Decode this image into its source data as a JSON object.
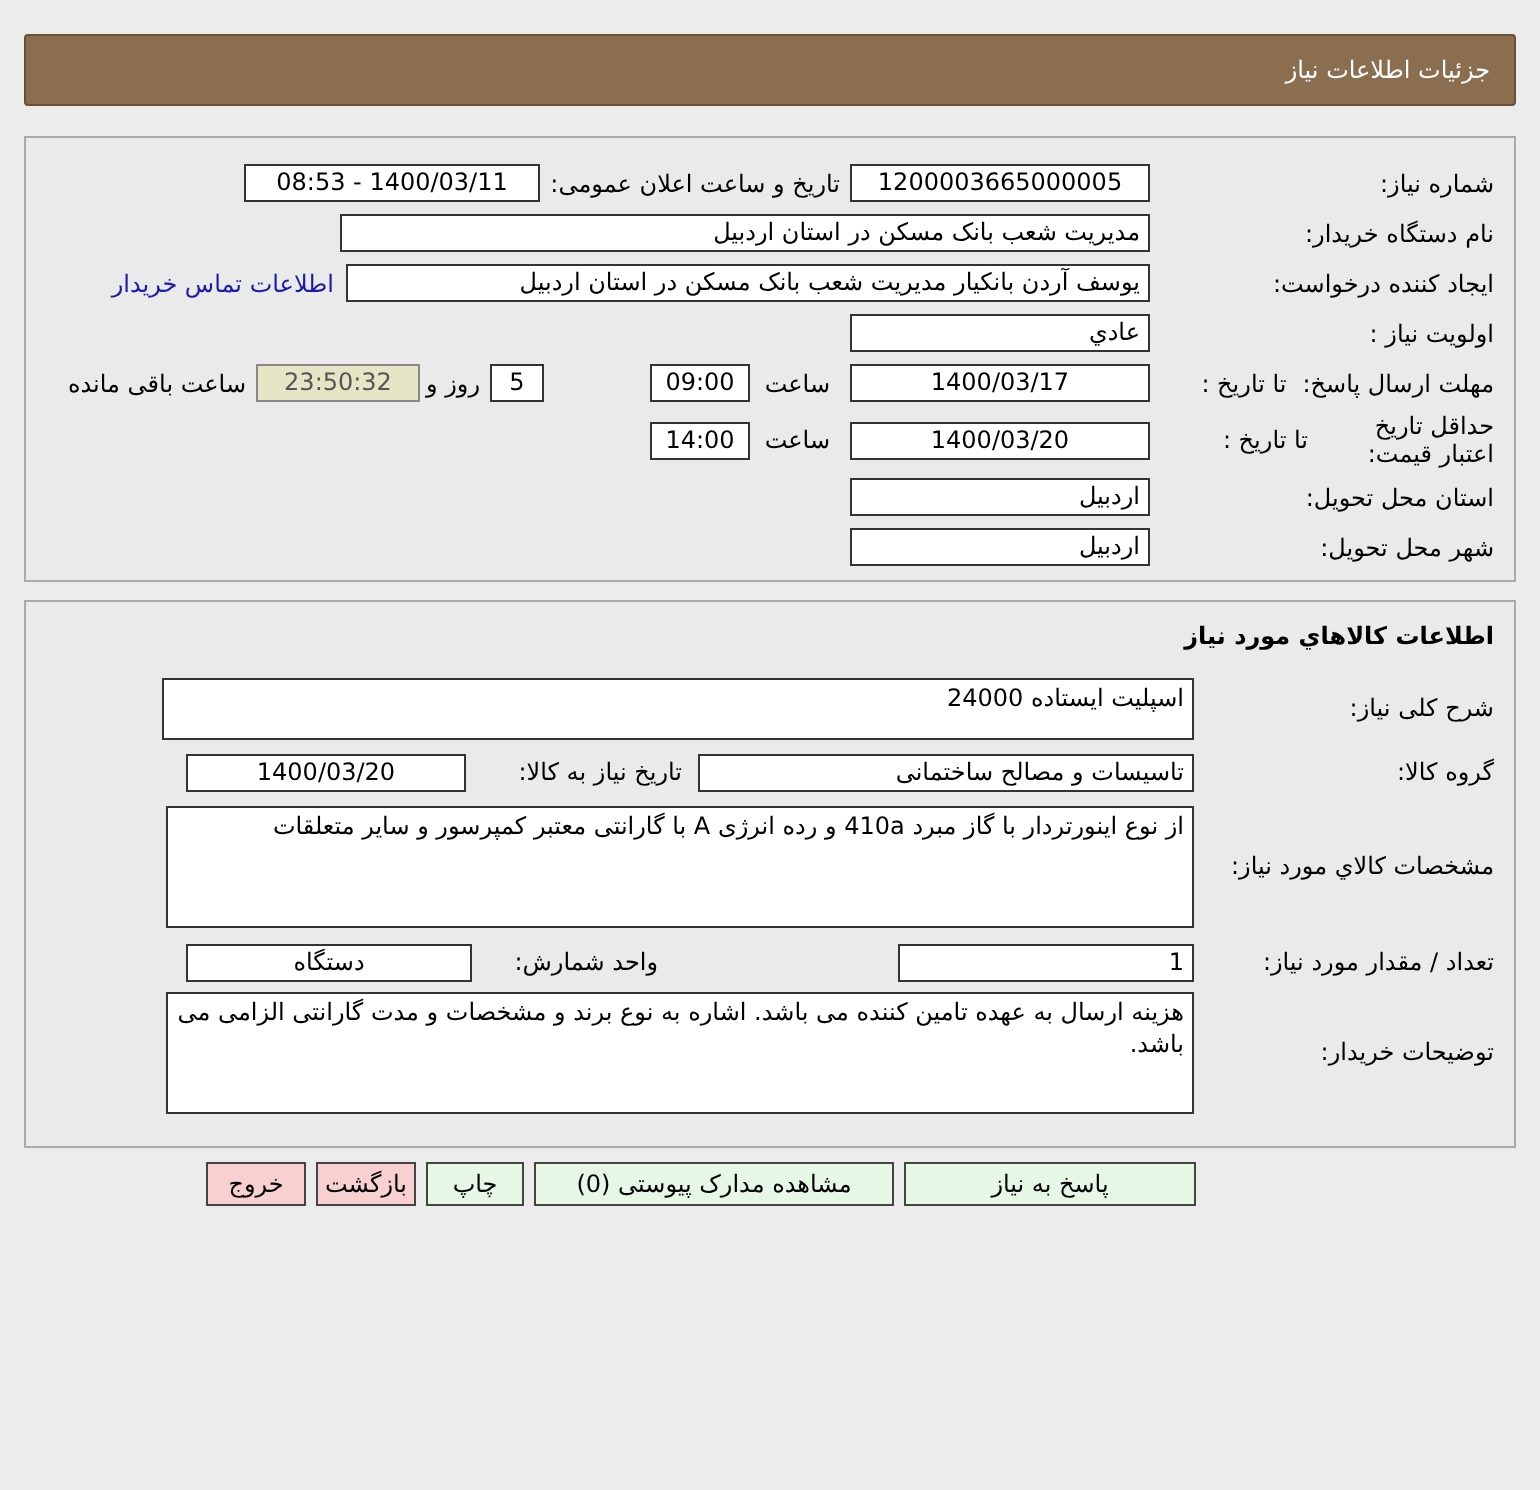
{
  "header": {
    "title": "جزئیات اطلاعات نیاز"
  },
  "general": {
    "rows": [
      {
        "label": "شماره نیاز:",
        "items": [
          {
            "kind": "field",
            "value": "1200003665000005"
          },
          {
            "kind": "label",
            "text": "تاریخ و ساعت اعلان عمومی:"
          },
          {
            "kind": "field",
            "value": "1400/03/11 - 08:53"
          }
        ]
      },
      {
        "label": "نام دستگاه خریدار:",
        "items": [
          {
            "kind": "field",
            "value": "مدیریت شعب بانک مسکن در استان اردبیل"
          }
        ]
      },
      {
        "label": "ایجاد کننده درخواست:",
        "items": [
          {
            "kind": "field",
            "value": "یوسف  آردن بانکیار مدیریت شعب بانک مسکن در استان اردبیل"
          },
          {
            "kind": "link",
            "text": "اطلاعات تماس خریدار"
          }
        ]
      },
      {
        "label": "اولویت نیاز :",
        "items": [
          {
            "kind": "field",
            "value": "عادي"
          }
        ]
      },
      {
        "label": "مهلت ارسال پاسخ:",
        "sublabel": "تا تاریخ :",
        "items": [
          {
            "kind": "field",
            "value": "1400/03/17"
          },
          {
            "kind": "label",
            "text": "ساعت"
          },
          {
            "kind": "field",
            "value": "09:00"
          },
          {
            "kind": "field",
            "value": "5"
          },
          {
            "kind": "label",
            "text": "روز و"
          },
          {
            "kind": "timer",
            "value": "23:50:32"
          },
          {
            "kind": "label",
            "text": "ساعت باقی مانده"
          }
        ]
      },
      {
        "label": "حداقل تاریخ اعتبار قیمت:",
        "sublabel": "تا تاریخ :",
        "items": [
          {
            "kind": "field",
            "value": "1400/03/20"
          },
          {
            "kind": "label",
            "text": "ساعت"
          },
          {
            "kind": "field",
            "value": "14:00"
          }
        ]
      },
      {
        "label": "استان محل تحویل:",
        "items": [
          {
            "kind": "field",
            "value": "اردبیل"
          }
        ]
      },
      {
        "label": "شهر محل تحویل:",
        "items": [
          {
            "kind": "field",
            "value": "اردبیل"
          }
        ]
      }
    ]
  },
  "goods": {
    "title": "اطلاعات کالاهاي مورد نیاز",
    "rows": [
      {
        "label": "شرح کلی نیاز:",
        "items": [
          {
            "kind": "area",
            "value": "اسپلیت ایستاده 24000"
          }
        ]
      },
      {
        "label": "گروه کالا:",
        "items": [
          {
            "kind": "field",
            "value": "تاسیسات و مصالح ساختمانی"
          },
          {
            "kind": "label",
            "text": "تاریخ نیاز به کالا:"
          },
          {
            "kind": "field",
            "value": "1400/03/20"
          }
        ]
      },
      {
        "label": "مشخصات کالاي مورد نیاز:",
        "items": [
          {
            "kind": "area",
            "value": "از نوع اینورتردار با گاز مبرد 410a و رده انرژی A با گارانتی معتبر کمپرسور و سایر متعلقات"
          }
        ]
      },
      {
        "label": "تعداد / مقدار مورد نیاز:",
        "items": [
          {
            "kind": "field",
            "value": "1"
          },
          {
            "kind": "label",
            "text": "واحد شمارش:"
          },
          {
            "kind": "field",
            "value": "دستگاه"
          }
        ]
      },
      {
        "label": "توضیحات خریدار:",
        "items": [
          {
            "kind": "area",
            "value": "هزینه ارسال به عهده تامین کننده می باشد. اشاره به نوع برند و مشخصات و مدت گارانتی الزامی می باشد."
          }
        ]
      }
    ]
  },
  "buttons": [
    {
      "label": "پاسخ به نیاز",
      "kind": "primary"
    },
    {
      "label": "مشاهده مدارک پیوستی (0)",
      "kind": "primary"
    },
    {
      "label": "چاپ",
      "kind": "primary"
    },
    {
      "label": "بازگشت",
      "kind": "danger"
    },
    {
      "label": "خروج",
      "kind": "danger"
    }
  ]
}
